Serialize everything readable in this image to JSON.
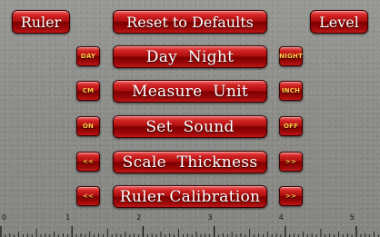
{
  "top": {
    "ruler_label": "Ruler",
    "reset_label": "Reset to Defaults",
    "level_label": "Level"
  },
  "rows": [
    {
      "left": "DAY",
      "center": "Day  Night",
      "right": "NIGHT"
    },
    {
      "left": "CM",
      "center": "Measure  Unit",
      "right": "INCH"
    },
    {
      "left": "ON",
      "center": "Set  Sound",
      "right": "OFF"
    },
    {
      "left": "<<",
      "center": "Scale  Thickness",
      "right": ">>"
    },
    {
      "left": "<<",
      "center": "Ruler Calibration",
      "right": ">>"
    }
  ],
  "ruler": {
    "unit": "inch",
    "labels": [
      "0",
      "1",
      "2",
      "3",
      "4",
      "5"
    ]
  }
}
